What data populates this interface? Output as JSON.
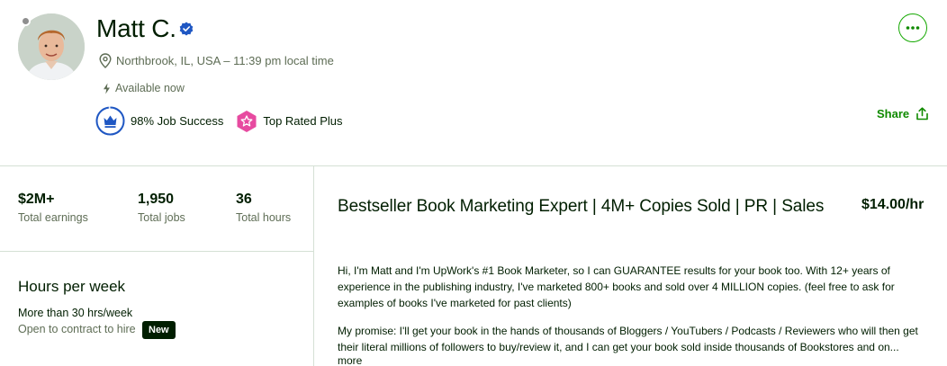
{
  "profile": {
    "name": "Matt C.",
    "location": "Northbrook, IL, USA – 11:39 pm local time",
    "availability": "Available now",
    "job_success": "98% Job Success",
    "job_success_value": 98,
    "top_rated": "Top Rated Plus"
  },
  "actions": {
    "share_label": "Share"
  },
  "stats": [
    {
      "value": "$2M+",
      "label": "Total earnings"
    },
    {
      "value": "1,950",
      "label": "Total jobs"
    },
    {
      "value": "36",
      "label": "Total hours"
    }
  ],
  "hours": {
    "title": "Hours per week",
    "value": "More than 30 hrs/week",
    "contract": "Open to contract to hire",
    "new_badge": "New"
  },
  "main": {
    "title": "Bestseller Book Marketing Expert | 4M+ Copies Sold | PR | Sales",
    "rate": "$14.00/hr",
    "desc_p1": "Hi, I'm Matt and I'm UpWork's #1 Book Marketer, so I can GUARANTEE results for your book too. With 12+ years of experience in the publishing industry, I've marketed 800+ books and sold over 4 MILLION copies. (feel free to ask for examples of books I've marketed for past clients)",
    "desc_p2": "My promise: I'll get your book in the hands of thousands of Bloggers / YouTubers / Podcasts / Reviewers who will then get their literal millions of followers to buy/review it, and I can get your book sold inside thousands of Bookstores and on...",
    "more_label": "more"
  },
  "colors": {
    "brand_green": "#108a00",
    "verified_blue": "#1f57c3",
    "top_rated_pink": "#e74aa0"
  }
}
